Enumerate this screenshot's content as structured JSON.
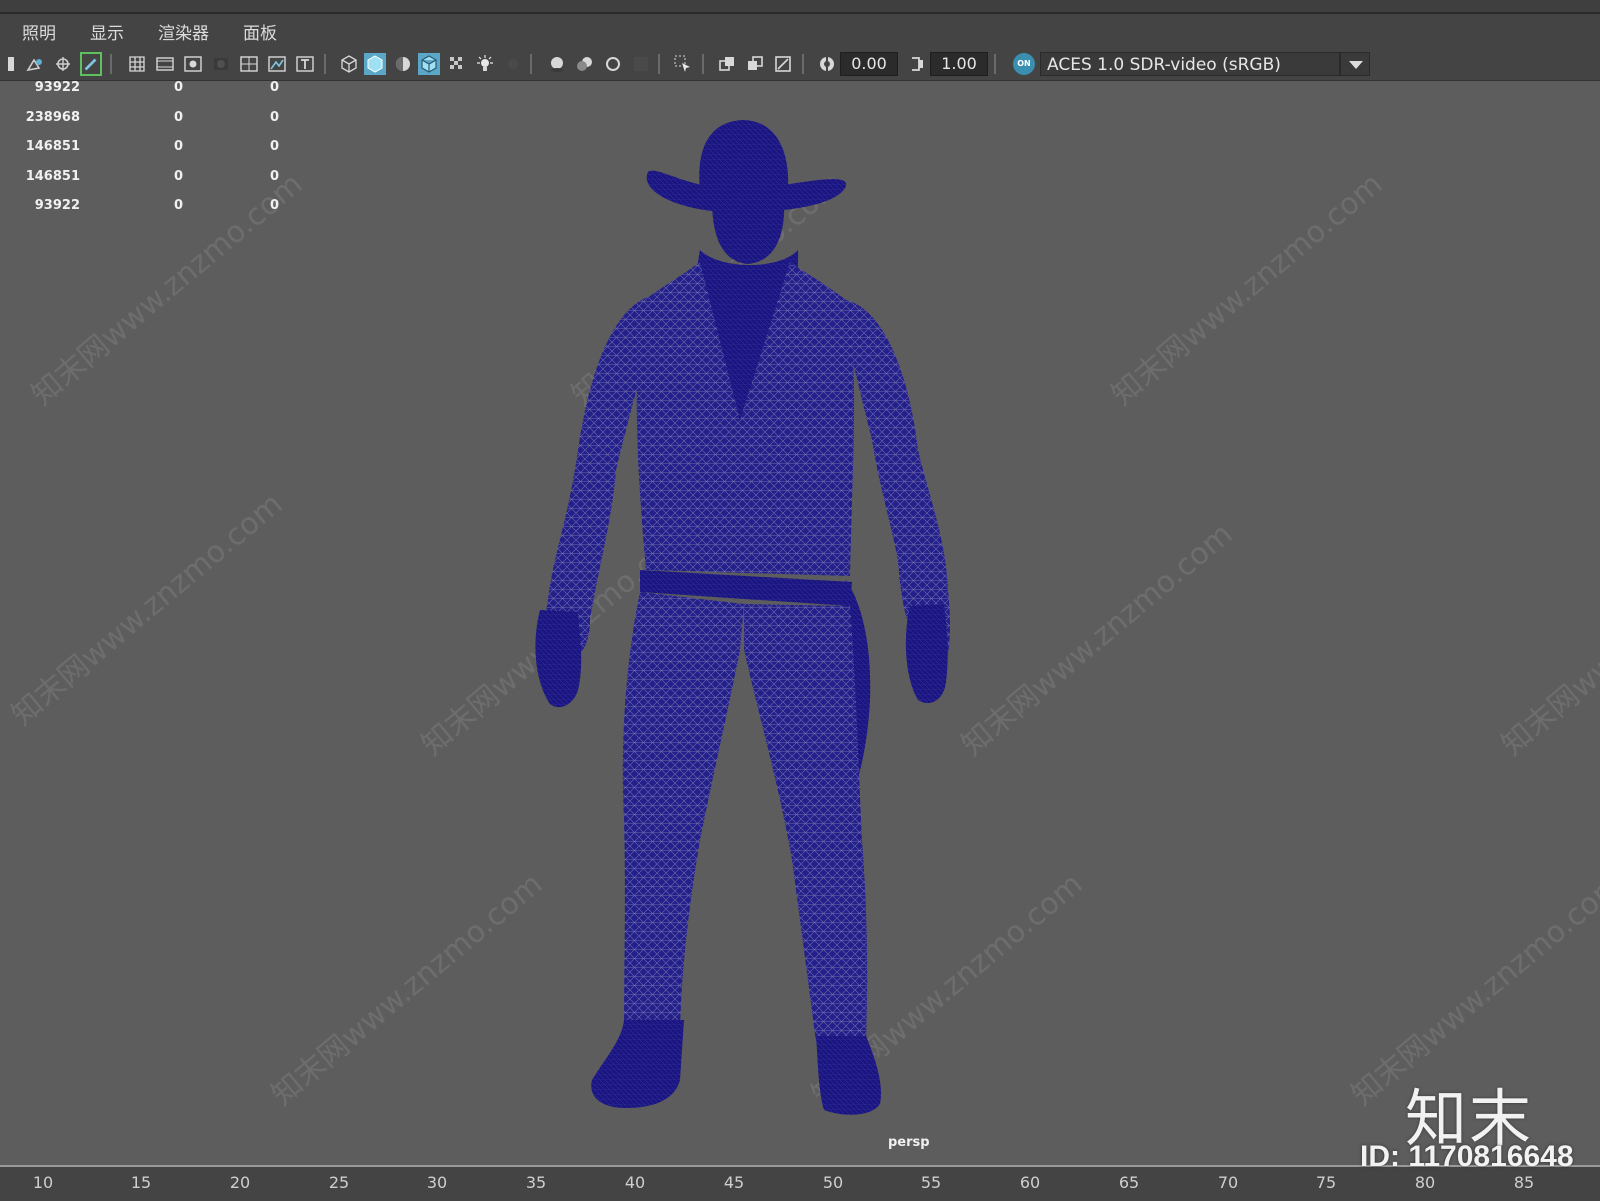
{
  "menu": [
    "照明",
    "显示",
    "渲染器",
    "面板"
  ],
  "toolbar": {
    "exposure_value": "0.00",
    "gamma_value": "1.00",
    "color_management_on": "ON",
    "color_space": "ACES 1.0 SDR-video (sRGB)",
    "icons": [
      "bookmark-icon",
      "camera-attributes-icon",
      "snap-camera-icon",
      "grease-pencil-icon",
      "grid-icon",
      "film-gate-icon",
      "resolution-gate-icon",
      "gate-mask-icon",
      "field-chart-icon",
      "safe-action-icon",
      "safe-title-icon",
      "wireframe-icon",
      "smooth-shade-icon",
      "default-material-icon",
      "wireframe-on-shaded-icon",
      "xray-icon",
      "use-all-lights-icon",
      "shadows-icon",
      "screen-space-ao-icon",
      "motion-blur-icon",
      "anti-aliasing-icon",
      "depth-of-field-icon",
      "isolate-select-icon",
      "xray-joints-icon",
      "xray-active-icon",
      "backface-icon",
      "exposure-icon",
      "gamma-icon"
    ]
  },
  "stats": [
    [
      "93922",
      "0",
      "0"
    ],
    [
      "238968",
      "0",
      "0"
    ],
    [
      "146851",
      "0",
      "0"
    ],
    [
      "146851",
      "0",
      "0"
    ],
    [
      "93922",
      "0",
      "0"
    ]
  ],
  "viewport": {
    "camera": "persp",
    "mesh_color": "#1a1580",
    "background": "#5d5d5d"
  },
  "timeline": {
    "ticks": [
      "10",
      "15",
      "20",
      "25",
      "30",
      "35",
      "40",
      "45",
      "50",
      "55",
      "60",
      "65",
      "70",
      "75",
      "80",
      "85"
    ]
  },
  "watermark": {
    "logo": "知末",
    "id": "ID: 1170816648",
    "repeat_text": "知末网www.znzmo.com"
  }
}
